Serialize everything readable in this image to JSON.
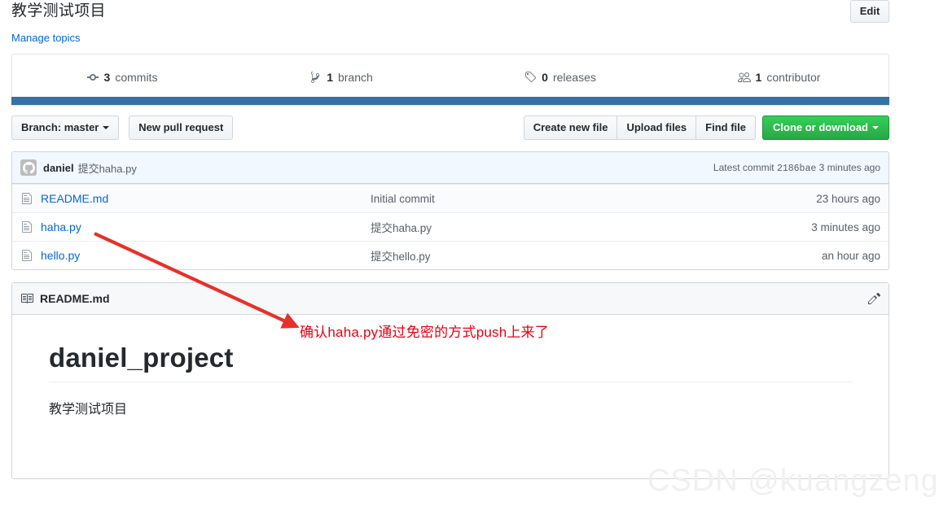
{
  "header": {
    "description": "教学测试项目",
    "manage_topics_label": "Manage topics",
    "edit_button_label": "Edit"
  },
  "stats": [
    {
      "icon": "commit-icon",
      "count": "3",
      "label": "commits"
    },
    {
      "icon": "branch-icon",
      "count": "1",
      "label": "branch"
    },
    {
      "icon": "tag-icon",
      "count": "0",
      "label": "releases"
    },
    {
      "icon": "people-icon",
      "count": "1",
      "label": "contributor"
    }
  ],
  "language_bar": {
    "color": "#3572A5"
  },
  "toolbar": {
    "branch_label": "Branch: master",
    "new_pull_request_label": "New pull request",
    "create_new_file_label": "Create new file",
    "upload_files_label": "Upload files",
    "find_file_label": "Find file",
    "clone_or_download_label": "Clone or download"
  },
  "latest_commit": {
    "author": "daniel",
    "message": "提交haha.py",
    "prefix": "Latest commit",
    "sha": "2186bae",
    "age": "3 minutes ago"
  },
  "files": [
    {
      "icon": "file-icon",
      "name": "README.md",
      "message": "Initial commit",
      "age": "23 hours ago"
    },
    {
      "icon": "file-icon",
      "name": "haha.py",
      "message": "提交haha.py",
      "age": "3 minutes ago"
    },
    {
      "icon": "file-icon",
      "name": "hello.py",
      "message": "提交hello.py",
      "age": "an hour ago"
    }
  ],
  "readme": {
    "icon": "book-icon",
    "title": "README.md",
    "edit_icon": "pencil-icon",
    "heading": "daniel_project",
    "paragraph": "教学测试项目"
  },
  "annotation": {
    "text": "确认haha.py通过免密的方式push上来了",
    "color": "#e60012"
  },
  "watermark": {
    "text": "CSDN @kuangzeng"
  }
}
